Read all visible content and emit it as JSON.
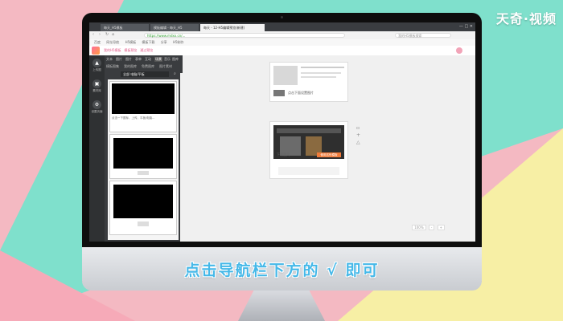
{
  "watermark": "天奇·视频",
  "caption": "点击导航栏下方的 √ 即可",
  "browser": {
    "tabs": [
      "每天_H5模板",
      "模板编辑 - 每天_H5",
      "每天 - 12-H5编辑预览(新建)"
    ],
    "url": "https://www.mdxx.cn/...",
    "search_placeholder": "我的H5模板搜索",
    "bookmarks": [
      "百度",
      "网址导航",
      "H5模板",
      "模板下载",
      "分享",
      "H5制作"
    ]
  },
  "app": {
    "nav": [
      "我的H5模板",
      "模板预览",
      "通过预览"
    ],
    "sidebar": [
      "上传图",
      "素材库",
      "设置页面"
    ],
    "panel_tabs": [
      "文本",
      "图片",
      "图片",
      "表单",
      "互动",
      "场景",
      "音乐",
      "图库"
    ],
    "panel_subtabs": [
      "模板图集",
      "我的图库",
      "免费图库",
      "图片素材"
    ],
    "filter_label": "全部 电脑/平板",
    "flyout_label": "上传图片",
    "card_caption": "点击一下图标，上传，平板/电脑...",
    "card1_text": "点击下面设置图片",
    "card2_text": "下载量大",
    "card2_button": "使用这份模板",
    "right_tools": [
      "预览",
      "设置",
      "发布",
      "分享",
      "保存"
    ],
    "zoom": [
      "100%",
      "-",
      "+"
    ]
  },
  "colors": {
    "accent": "#45b8e8",
    "brand": "#e25b8a"
  }
}
